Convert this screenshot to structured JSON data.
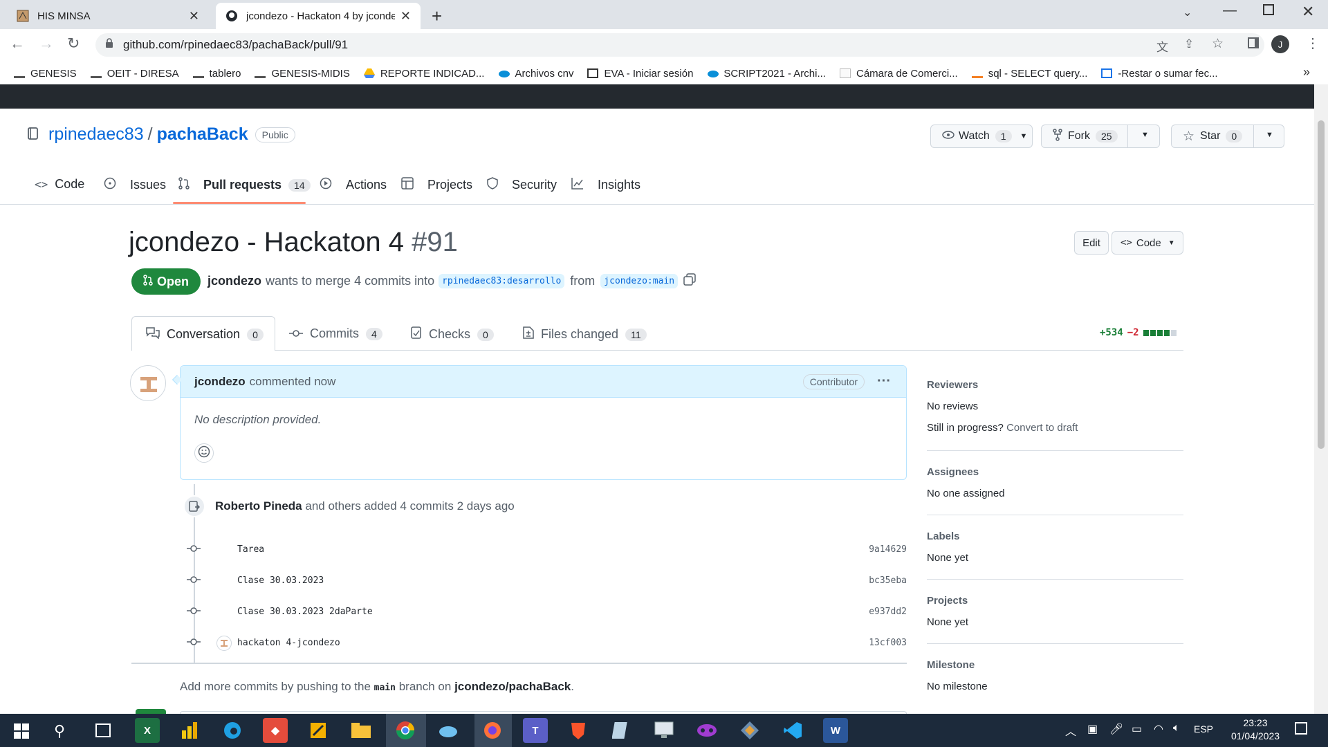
{
  "browser": {
    "tabs": [
      {
        "title": "HIS MINSA",
        "active": false
      },
      {
        "title": "jcondezo - Hackaton 4 by jconde",
        "active": true
      }
    ],
    "url": "github.com/rpinedaec83/pachaBack/pull/91",
    "profile_initial": "J",
    "bookmarks": [
      "GENESIS",
      "OEIT - DIRESA",
      "tablero",
      "GENESIS-MIDIS",
      "REPORTE INDICAD...",
      "Archivos cnv",
      "EVA - Iniciar sesión",
      "SCRIPT2021 - Archi...",
      "Cámara de Comerci...",
      "sql - SELECT query...",
      "-Restar o sumar fec..."
    ],
    "bookmarks_more": "»"
  },
  "repo": {
    "owner": "rpinedaec83",
    "separator": "/",
    "name": "pachaBack",
    "visibility": "Public",
    "watch_label": "Watch",
    "watch_count": "1",
    "fork_label": "Fork",
    "fork_count": "25",
    "star_label": "Star",
    "star_count": "0",
    "nav": [
      {
        "label": "Code",
        "count": ""
      },
      {
        "label": "Issues",
        "count": ""
      },
      {
        "label": "Pull requests",
        "count": "14"
      },
      {
        "label": "Actions",
        "count": ""
      },
      {
        "label": "Projects",
        "count": ""
      },
      {
        "label": "Security",
        "count": ""
      },
      {
        "label": "Insights",
        "count": ""
      }
    ]
  },
  "pr": {
    "title": "jcondezo - Hackaton 4",
    "number": "#91",
    "edit_label": "Edit",
    "code_label": "Code",
    "state": "Open",
    "author": "jcondezo",
    "merge_text": "wants to merge 4 commits into",
    "base_branch": "rpinedaec83:desarrollo",
    "from_text": "from",
    "head_branch": "jcondezo:main",
    "tabs": [
      {
        "label": "Conversation",
        "count": "0"
      },
      {
        "label": "Commits",
        "count": "4"
      },
      {
        "label": "Checks",
        "count": "0"
      },
      {
        "label": "Files changed",
        "count": "11"
      }
    ],
    "additions": "+534",
    "deletions": "−2"
  },
  "comment": {
    "author": "jcondezo",
    "meta": "commented now",
    "badge": "Contributor",
    "body": "No description provided."
  },
  "commits_event": {
    "author": "Roberto Pineda",
    "text": "and others added 4 commits 2 days ago",
    "commits": [
      {
        "message": "Tarea",
        "sha": "9a14629"
      },
      {
        "message": "Clase 30.03.2023",
        "sha": "bc35eba"
      },
      {
        "message": "Clase 30.03.2023 2daParte",
        "sha": "e937dd2"
      },
      {
        "message": "hackaton 4-jcondezo",
        "sha": "13cf003"
      }
    ]
  },
  "footer_note": {
    "prefix": "Add more commits by pushing to the",
    "branch": "main",
    "middle": "branch on",
    "repo": "jcondezo/pachaBack",
    "suffix": "."
  },
  "sidebar": {
    "reviewers_h": "Reviewers",
    "reviewers_v": "No reviews",
    "progress_q": "Still in progress?",
    "progress_link": "Convert to draft",
    "assignees_h": "Assignees",
    "assignees_v": "No one assigned",
    "labels_h": "Labels",
    "labels_v": "None yet",
    "projects_h": "Projects",
    "projects_v": "None yet",
    "milestone_h": "Milestone",
    "milestone_v": "No milestone"
  },
  "taskbar": {
    "lang": "ESP",
    "time": "23:23",
    "date": "01/04/2023"
  },
  "colors": {
    "open_green": "#1f883d",
    "link_blue": "#0969da",
    "nav_underline": "#fd8c73",
    "comment_header": "#ddf4ff"
  }
}
